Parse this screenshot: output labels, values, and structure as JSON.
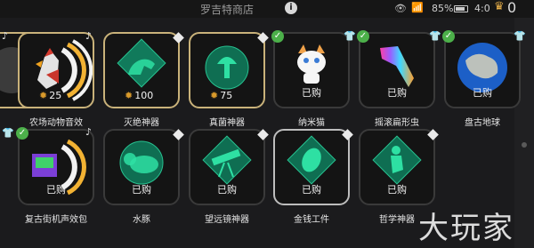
{
  "status_bar": {
    "shop_title": "罗吉特商店",
    "info": "i",
    "battery": "85%",
    "time": "4:0",
    "count": "0"
  },
  "row1": [
    {
      "label": "",
      "status": ""
    },
    {
      "label": "农场动物音效",
      "price": "25"
    },
    {
      "label": "灭绝神器",
      "price": "100"
    },
    {
      "label": "真菌神器",
      "price": "75"
    },
    {
      "label": "纳米猫",
      "status": "已购"
    },
    {
      "label": "摇滚扁形虫",
      "status": "已购"
    },
    {
      "label": "盘古地球",
      "status": "已购"
    }
  ],
  "row2": [
    {
      "label": "复古街机声效包",
      "status": "已购"
    },
    {
      "label": "水豚",
      "status": "已购"
    },
    {
      "label": "望远镜神器",
      "status": "已购"
    },
    {
      "label": "金钱工件",
      "status": "已购"
    },
    {
      "label": "哲学神器",
      "status": "已购"
    }
  ],
  "watermark": "大玩家",
  "colors": {
    "background": "#1b1b1d",
    "card_border_gold": "#c9b27a",
    "check_green": "#4cb04a",
    "artifact_green": "#1fa37a"
  }
}
